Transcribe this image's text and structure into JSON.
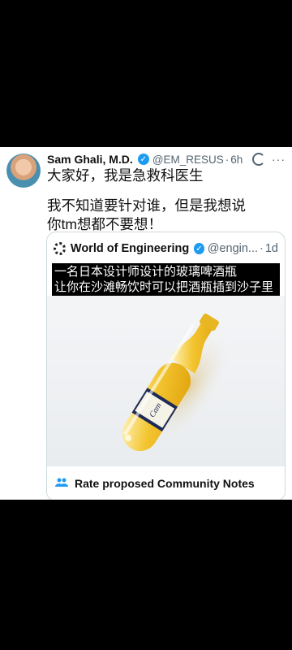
{
  "tweet": {
    "author_name": "Sam Ghali, M.D.",
    "verified_mark": "✓",
    "handle": "@EM_RESUS",
    "separator": "·",
    "time": "6h",
    "more": "···",
    "line1": "大家好，我是急救科医生",
    "line2": "我不知道要针对谁，但是我想说\n你tm想都不要想！"
  },
  "quote": {
    "name": "World of Engineering",
    "verified_mark": "✓",
    "handle": "@engin...",
    "separator": "·",
    "time": "1d",
    "caption_line1": "一名日本设计师设计的玻璃啤酒瓶",
    "caption_line2": "让你在沙滩畅饮时可以把酒瓶插到沙子里",
    "bottle_label": "Cam"
  },
  "community_notes": {
    "label": "Rate proposed Community Notes"
  },
  "colors": {
    "verified": "#1d9bf0",
    "handle": "#536471",
    "beer": "#f3c531"
  },
  "icons": [
    "grok-icon",
    "more-icon",
    "gear-icon",
    "people-icon"
  ]
}
